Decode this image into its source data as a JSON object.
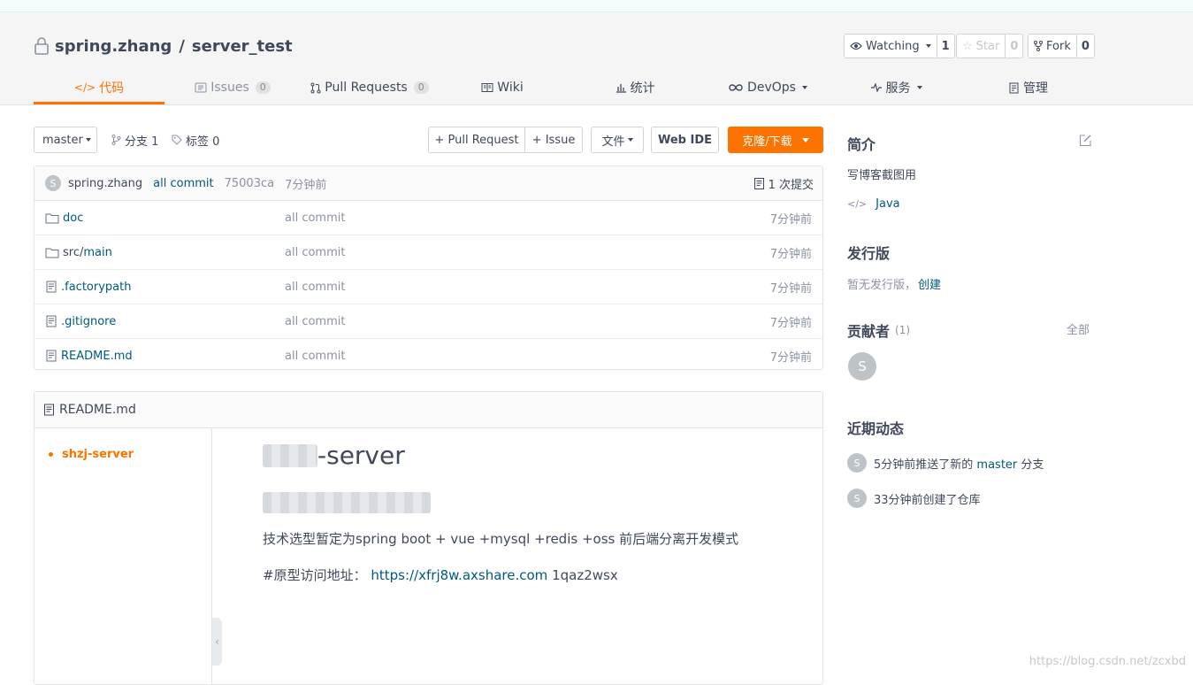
{
  "repo": {
    "owner": "spring.zhang",
    "separator": "/",
    "name": "server_test"
  },
  "actions": {
    "watch": {
      "label": "Watching",
      "count": "1"
    },
    "star": {
      "label": "Star",
      "count": "0"
    },
    "fork": {
      "label": "Fork",
      "count": "0"
    }
  },
  "tabs": [
    {
      "label": "代码"
    },
    {
      "label": "Issues",
      "badge": "0"
    },
    {
      "label": "Pull Requests",
      "badge": "0"
    },
    {
      "label": "Wiki"
    },
    {
      "label": "统计"
    },
    {
      "label": "DevOps"
    },
    {
      "label": "服务"
    },
    {
      "label": "管理"
    }
  ],
  "toolbar": {
    "branch": "master",
    "branches": "分支 1",
    "tags": "标签 0",
    "pull_request": "+ Pull Request",
    "issue": "+ Issue",
    "file": "文件",
    "web_ide": "Web IDE",
    "clone": "克隆/下载"
  },
  "commit": {
    "avatar": "S",
    "author": "spring.zhang",
    "message": "all commit",
    "hash": "75003ca",
    "time": "7分钟前",
    "count": "1 次提交"
  },
  "files": [
    {
      "name": "doc",
      "type": "folder",
      "message": "all commit",
      "time": "7分钟前"
    },
    {
      "name_prefix": "src/",
      "name": "main",
      "type": "folder",
      "message": "all commit",
      "time": "7分钟前"
    },
    {
      "name": ".factorypath",
      "type": "file",
      "message": "all commit",
      "time": "7分钟前"
    },
    {
      "name": ".gitignore",
      "type": "file",
      "message": "all commit",
      "time": "7分钟前"
    },
    {
      "name": "README.md",
      "type": "file",
      "message": "all commit",
      "time": "7分钟前"
    }
  ],
  "readme": {
    "title": "README.md",
    "toc": [
      "shzj-server"
    ],
    "heading_suffix": "-server",
    "paragraph1": "技术选型暂定为spring boot + vue +mysql +redis +oss 前后端分离开发模式",
    "paragraph2_label": "#原型访问地址：",
    "paragraph2_link": "https://xfrj8w.axshare.com",
    "paragraph2_suffix": "1qaz2wsx"
  },
  "sidebar": {
    "intro_title": "简介",
    "intro_text": "写博客截图用",
    "language": "Java",
    "release_title": "发行版",
    "release_text": "暂无发行版，",
    "release_link": "创建",
    "contributors_title": "贡献者",
    "contributors_count": "(1)",
    "contributors_all": "全部",
    "contributor_avatar": "S",
    "activity_title": "近期动态",
    "activities": [
      {
        "avatar": "S",
        "prefix": "5分钟前推送了新的",
        "link": "master",
        "suffix": "分支"
      },
      {
        "avatar": "S",
        "text": "33分钟前创建了仓库"
      }
    ]
  },
  "watermark": "https://blog.csdn.net/zcxbd",
  "colors": {
    "accent": "#fe7300",
    "link": "#005980",
    "text": "#40485b",
    "muted": "#8c92a4"
  }
}
